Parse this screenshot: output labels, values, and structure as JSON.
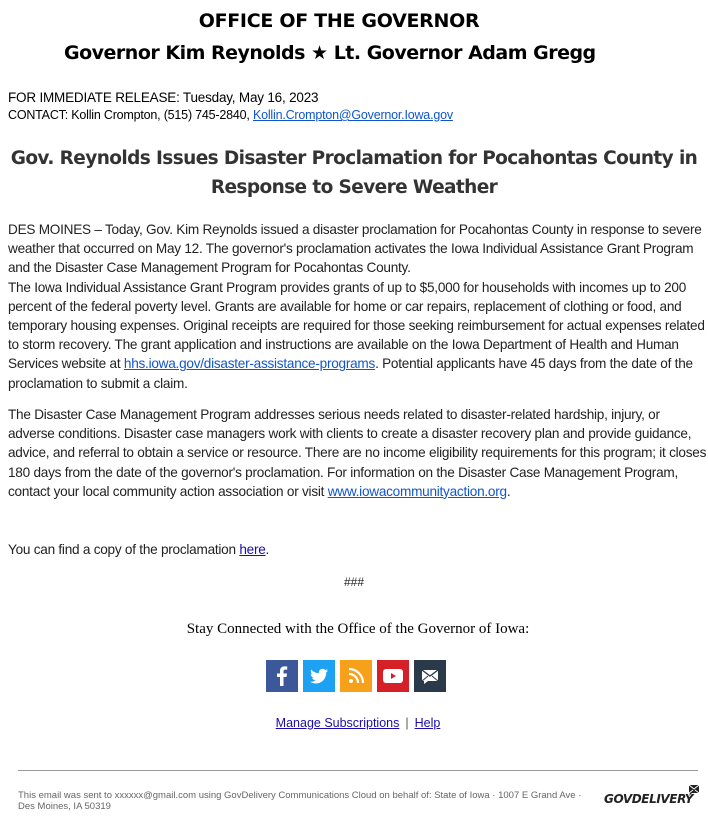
{
  "header": {
    "office": "OFFICE OF THE GOVERNOR",
    "governors_pre": "Governor Kim Reynolds ",
    "star": "★",
    "governors_post": " Lt. Governor Adam Gregg"
  },
  "meta": {
    "release": "FOR IMMEDIATE RELEASE: Tuesday, May 16, 2023",
    "contact_prefix": "CONTACT: Kollin Crompton, (515) 745-2840, ",
    "contact_email": "Kollin.Crompton@Governor.Iowa.gov"
  },
  "title": "Gov. Reynolds Issues Disaster Proclamation for Pocahontas County in Response to Severe Weather",
  "body": {
    "p1_a": "DES MOINES – Today, Gov. Kim Reynolds issued a disaster proclamation for Pocahontas County in response to severe weather that occurred on May 12. The governor's proclamation activates the Iowa Individual Assistance Grant Program and the Disaster Case Management Program for Pocahontas County.",
    "p1_b": "The Iowa Individual Assistance Grant Program provides grants of up to $5,000 for households with incomes up to 200 percent of the federal poverty level. Grants are available for home or car repairs, replacement of clothing or food, and temporary housing expenses. Original receipts are required for those seeking reimbursement for actual expenses related to storm recovery. The grant application and instructions are available on the Iowa Department of Health and Human Services website at ",
    "p1_link": "hhs.iowa.gov/disaster-assistance-programs",
    "p1_c": ". Potential applicants have 45 days from the date of the proclamation to submit a claim.",
    "p2_a": "The Disaster Case Management Program addresses serious needs related to disaster-related hardship, injury, or adverse conditions. Disaster case managers work with clients to create a disaster recovery plan and provide guidance, advice, and referral to obtain a service or resource. There are no income eligibility requirements for this program; it closes 180 days from the date of the governor's proclamation. For information on the Disaster Case Management Program, contact your local community action association or visit ",
    "p2_link": "www.iowacommunityaction.org",
    "p2_c": ".",
    "p3_a": "You can find a copy of the proclamation ",
    "p3_link": "here",
    "p3_c": "."
  },
  "end_mark": "###",
  "stay_connected": "Stay Connected with the Office of the Governor of Iowa:",
  "social": [
    {
      "name": "facebook",
      "icon": "facebook-icon",
      "color": "#3b5998"
    },
    {
      "name": "twitter",
      "icon": "twitter-icon",
      "color": "#1da1f2"
    },
    {
      "name": "rss",
      "icon": "rss-icon",
      "color": "#f7a11a"
    },
    {
      "name": "youtube",
      "icon": "youtube-icon",
      "color": "#d52027"
    },
    {
      "name": "email",
      "icon": "email-icon",
      "color": "#2a3a4a"
    }
  ],
  "footer_links": {
    "manage": "Manage Subscriptions",
    "sep": "|",
    "help": "Help"
  },
  "footer": {
    "text": "This email was sent to xxxxxx@gmail.com using GovDelivery Communications Cloud on behalf of: State of Iowa · 1007 E Grand Ave · Des Moines, IA 50319",
    "logo": "GOVDELIVERY"
  }
}
